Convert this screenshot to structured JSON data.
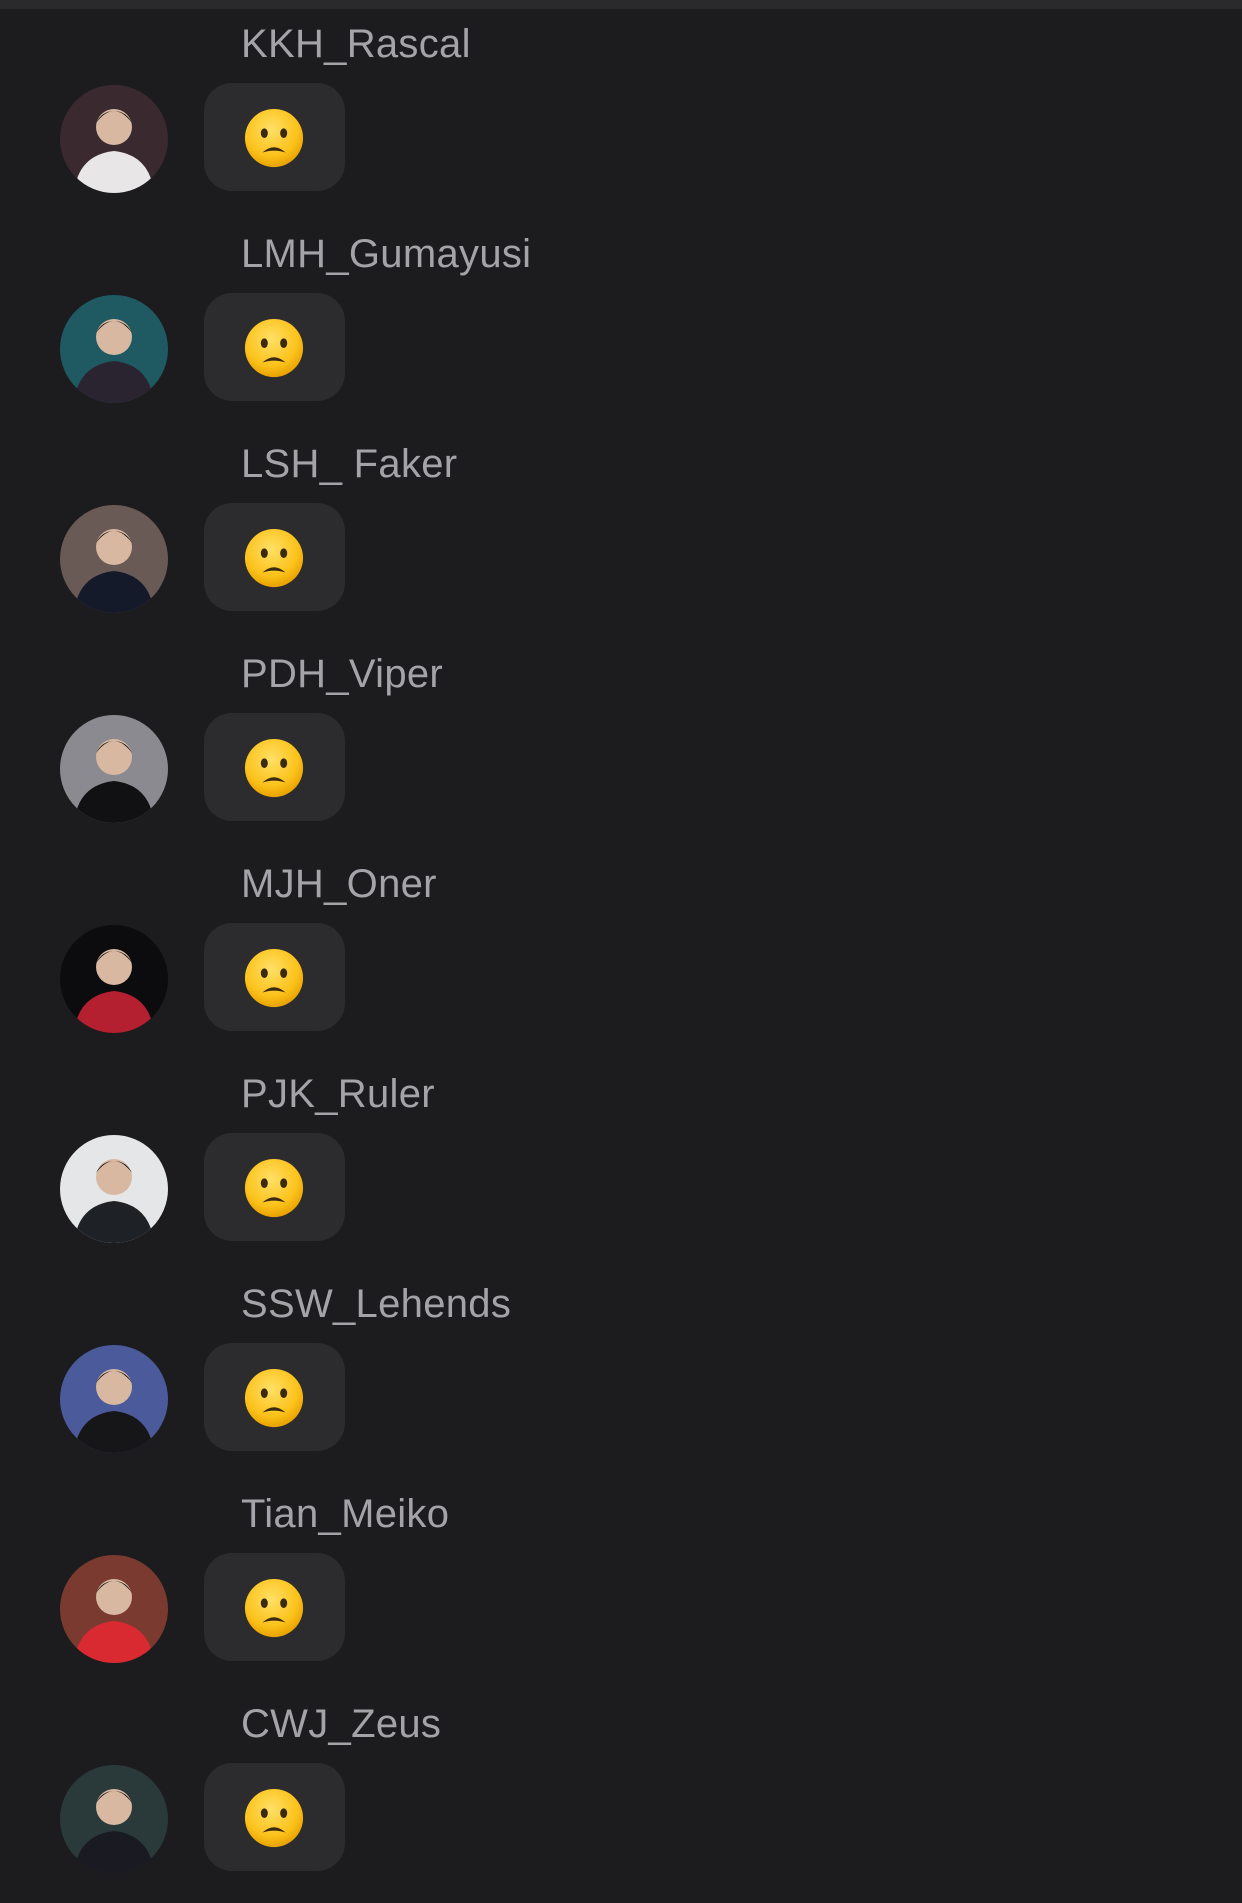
{
  "messages": [
    {
      "sender": "KKH_Rascal",
      "emoji_icon": "frowning-face-emoji",
      "avatar_bg": "#3a2a30",
      "avatar_fg": "#e8e6e6"
    },
    {
      "sender": "LMH_Gumayusi",
      "emoji_icon": "frowning-face-emoji",
      "avatar_bg": "#1f5a63",
      "avatar_fg": "#2a2430"
    },
    {
      "sender": "LSH_ Faker",
      "emoji_icon": "frowning-face-emoji",
      "avatar_bg": "#6a5a55",
      "avatar_fg": "#151a2a"
    },
    {
      "sender": "PDH_Viper",
      "emoji_icon": "frowning-face-emoji",
      "avatar_bg": "#8a8a90",
      "avatar_fg": "#111114"
    },
    {
      "sender": "MJH_Oner",
      "emoji_icon": "frowning-face-emoji",
      "avatar_bg": "#0c0c0e",
      "avatar_fg": "#b52030"
    },
    {
      "sender": "PJK_Ruler",
      "emoji_icon": "frowning-face-emoji",
      "avatar_bg": "#e4e6e8",
      "avatar_fg": "#1e2226"
    },
    {
      "sender": "SSW_Lehends",
      "emoji_icon": "frowning-face-emoji",
      "avatar_bg": "#4a5a9a",
      "avatar_fg": "#161618"
    },
    {
      "sender": "Tian_Meiko",
      "emoji_icon": "frowning-face-emoji",
      "avatar_bg": "#7a3a30",
      "avatar_fg": "#d82a30"
    },
    {
      "sender": "CWJ_Zeus",
      "emoji_icon": "frowning-face-emoji",
      "avatar_bg": "#2a3a3a",
      "avatar_fg": "#1a1a22"
    }
  ],
  "colors": {
    "background": "#1c1c1e",
    "bubble": "#2c2c2e",
    "name_text": "#a3a3a8",
    "emoji_face": "#fcc21b"
  }
}
